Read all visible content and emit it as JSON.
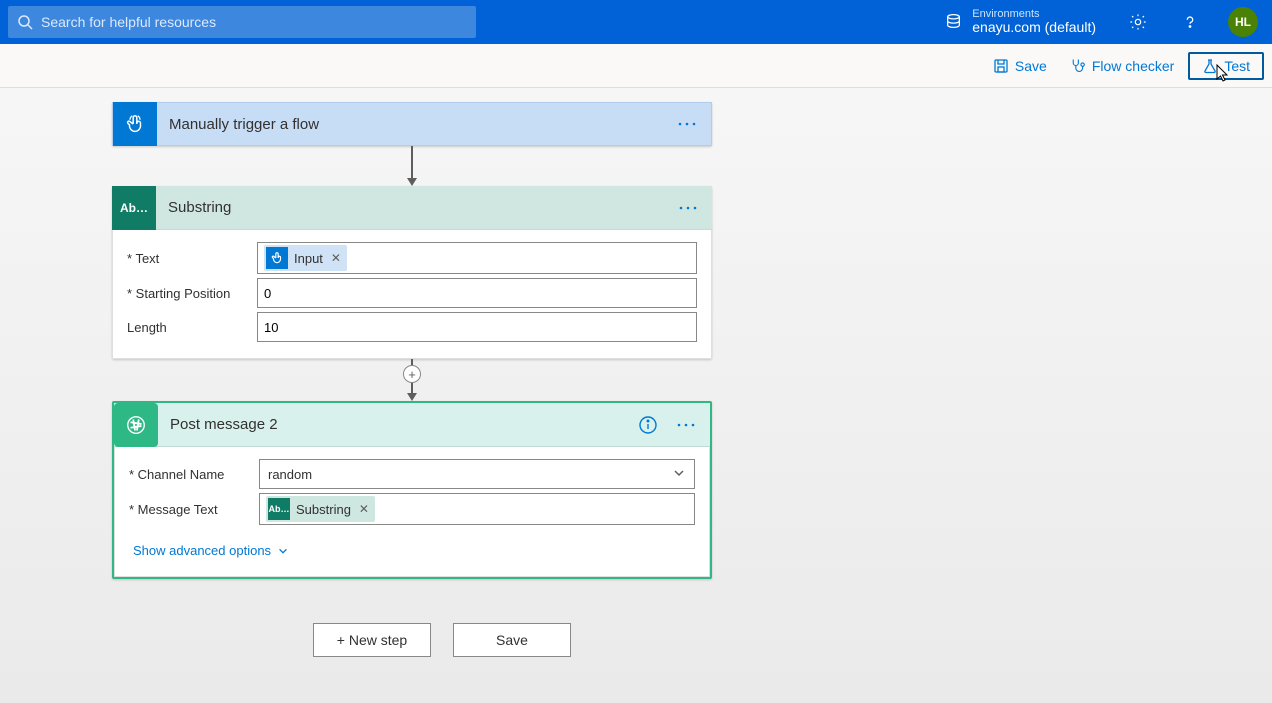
{
  "header": {
    "search_placeholder": "Search for helpful resources",
    "environments_label": "Environments",
    "environment_name": "enayu.com (default)",
    "avatar_initials": "HL"
  },
  "cmdbar": {
    "save": "Save",
    "flow_checker": "Flow checker",
    "test": "Test"
  },
  "steps": {
    "trigger": {
      "title": "Manually trigger a flow"
    },
    "substring": {
      "title": "Substring",
      "icon_text": "Ab…",
      "fields": {
        "text_label": "Text",
        "text_token": "Input",
        "starting_label": "Starting Position",
        "starting_value": "0",
        "length_label": "Length",
        "length_value": "10"
      }
    },
    "post": {
      "title": "Post message 2",
      "fields": {
        "channel_label": "Channel Name",
        "channel_value": "random",
        "message_label": "Message Text",
        "message_token": "Substring",
        "message_token_icon": "Ab…"
      },
      "show_advanced": "Show advanced options"
    }
  },
  "footer": {
    "new_step": "+ New step",
    "save": "Save"
  }
}
